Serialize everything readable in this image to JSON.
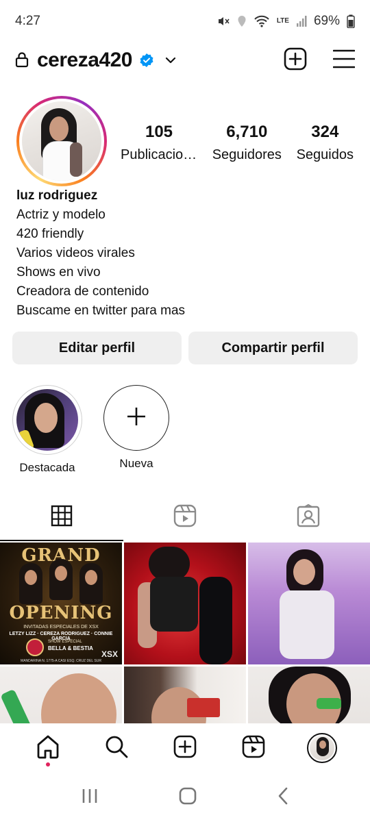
{
  "status_bar": {
    "time": "4:27",
    "battery": "69%",
    "network": "LTE"
  },
  "header": {
    "username": "cereza420"
  },
  "profile": {
    "stats": [
      {
        "value": "105",
        "label": "Publicaciones"
      },
      {
        "value": "6,710",
        "label": "Seguidores"
      },
      {
        "value": "324",
        "label": "Seguidos"
      }
    ],
    "name": "luz rodriguez",
    "bio": [
      "Actriz y modelo",
      "420 friendly",
      "Varios videos virales",
      "Shows en vivo",
      "Creadora de contenido",
      "Buscame en twitter para mas"
    ]
  },
  "actions": {
    "edit": "Editar perfil",
    "share": "Compartir perfil"
  },
  "highlights": [
    {
      "label": "Destacada"
    },
    {
      "label": "Nueva"
    }
  ],
  "tabs": [
    {
      "icon": "grid-icon",
      "active": true
    },
    {
      "icon": "reels-icon",
      "active": false
    },
    {
      "icon": "tagged-icon",
      "active": false
    }
  ],
  "posts": {
    "grand_opening": {
      "title_top": "GRAND",
      "title_bottom": "OPENING",
      "subtitle": "INVITADAS ESPECIALES DE XSX",
      "names": "LETZY LIZZ · CEREZA RODRIGUEZ · CONNIE GARCIA",
      "show": "SHOW ESPECIAL",
      "show_name": "BELLA & BESTIA",
      "address": "MANDARINA N. 1775-A CASI ESQ. CRUZ DEL SUR",
      "logo": "XSX"
    }
  },
  "bottom_nav": [
    "home-icon",
    "search-icon",
    "create-icon",
    "reels-icon",
    "profile-avatar"
  ],
  "colors": {
    "verified": "#0095f6",
    "button_bg": "#efefef",
    "notification_dot": "#e0245e"
  }
}
